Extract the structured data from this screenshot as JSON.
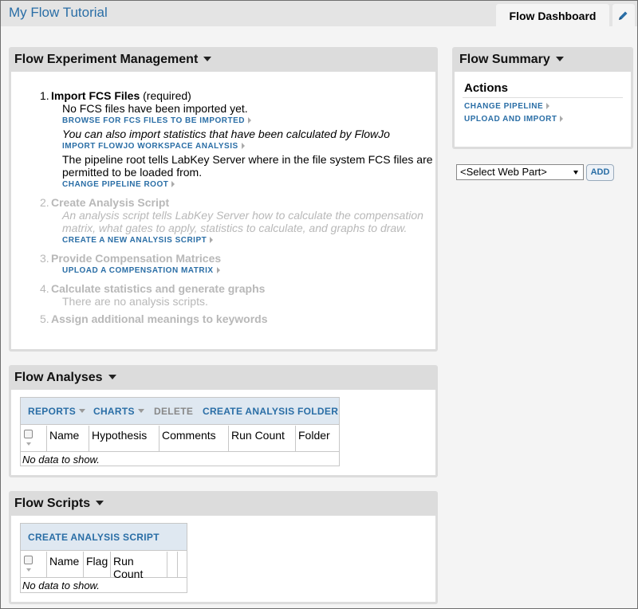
{
  "app": {
    "title": "My Flow Tutorial",
    "tab": "Flow Dashboard"
  },
  "mgmt": {
    "title": "Flow Experiment Management",
    "steps": [
      {
        "number": "1.",
        "title": "Import FCS Files",
        "suffix": " (required)",
        "lines": [
          {
            "type": "text",
            "text": "No FCS files have been imported yet."
          },
          {
            "type": "link",
            "text": "BROWSE FOR FCS FILES TO BE IMPORTED"
          },
          {
            "type": "italic",
            "text": "You can also import statistics that have been calculated by FlowJo"
          },
          {
            "type": "link",
            "text": "IMPORT FLOWJO WORKSPACE ANALYSIS"
          },
          {
            "type": "text",
            "text": "The pipeline root tells LabKey Server where in the file system FCS files are"
          },
          {
            "type": "text",
            "text": "permitted to be loaded from."
          },
          {
            "type": "link",
            "text": "CHANGE PIPELINE ROOT"
          }
        ]
      },
      {
        "number": "2.",
        "title": "Create Analysis Script",
        "lines": [
          {
            "type": "italic",
            "text": "An analysis script tells LabKey Server how to calculate the compensation"
          },
          {
            "type": "italic",
            "text": "matrix, what gates to apply, statistics to calculate, and graphs to draw."
          },
          {
            "type": "link",
            "text": "CREATE A NEW ANALYSIS SCRIPT"
          }
        ]
      },
      {
        "number": "3.",
        "title": "Provide Compensation Matrices",
        "lines": [
          {
            "type": "link",
            "text": "UPLOAD A COMPENSATION MATRIX"
          }
        ]
      },
      {
        "number": "4.",
        "title": "Calculate statistics and generate graphs",
        "lines": [
          {
            "type": "text",
            "text": "There are no analysis scripts."
          }
        ]
      },
      {
        "number": "5.",
        "title": "Assign additional meanings to keywords",
        "lines": []
      }
    ]
  },
  "analyses": {
    "title": "Flow Analyses",
    "buttons": {
      "reports": "REPORTS",
      "charts": "CHARTS",
      "delete": "DELETE",
      "create": "CREATE ANALYSIS FOLDER"
    },
    "columns": [
      "Name",
      "Hypothesis",
      "Comments",
      "Run Count",
      "Folder"
    ],
    "empty": "No data to show."
  },
  "scripts": {
    "title": "Flow Scripts",
    "buttons": {
      "create": "CREATE ANALYSIS SCRIPT"
    },
    "columns": [
      "Name",
      "Flag",
      "Run Count"
    ],
    "empty": "No data to show."
  },
  "summary": {
    "title": "Flow Summary",
    "actions_heading": "Actions",
    "links": [
      "CHANGE PIPELINE",
      "UPLOAD AND IMPORT"
    ]
  },
  "webpart": {
    "select_value": "<Select Web Part>",
    "add_label": "ADD"
  }
}
